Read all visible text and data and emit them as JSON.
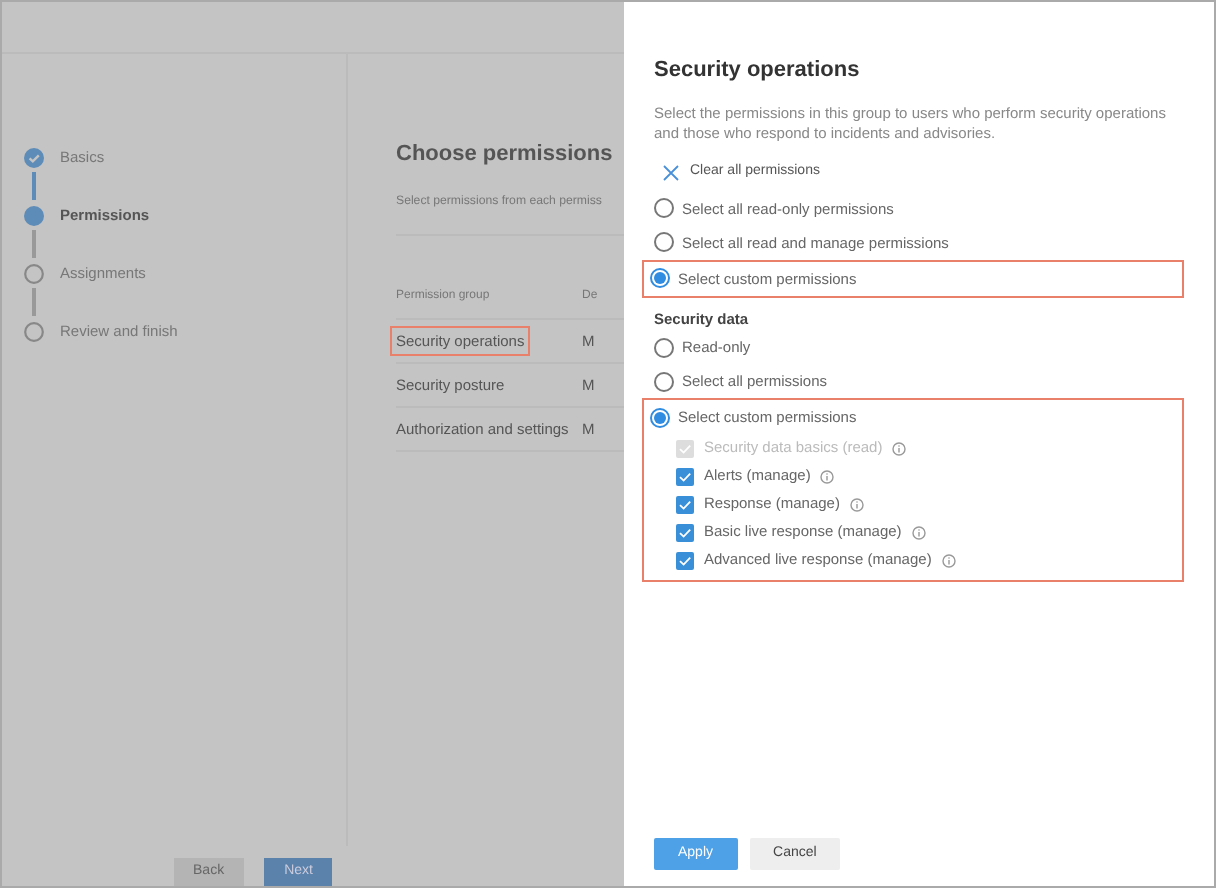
{
  "wizard": {
    "steps": [
      {
        "label": "Basics",
        "kind": "done"
      },
      {
        "label": "Permissions",
        "kind": "current"
      },
      {
        "label": "Assignments",
        "kind": "pending"
      },
      {
        "label": "Review and finish",
        "kind": "pending"
      }
    ],
    "title": "Choose permissions",
    "subtitle": "Select permissions from each permiss",
    "table": {
      "columns": [
        "Permission group",
        "De"
      ],
      "rows": [
        {
          "cells": [
            "Security operations",
            "M"
          ],
          "highlighted": true
        },
        {
          "cells": [
            "Security posture",
            "M"
          ],
          "highlighted": false
        },
        {
          "cells": [
            "Authorization and settings",
            "M"
          ],
          "highlighted": false
        }
      ]
    },
    "buttons": [
      "Back",
      "Next"
    ]
  },
  "panel": {
    "title": "Security operations",
    "description": "Select the permissions in this group to users who perform security operations and those who respond to incidents and advisories.",
    "clear_button": "Clear all permissions",
    "options": [
      {
        "label": "Select all read-only permissions",
        "selected": false,
        "highlighted": false
      },
      {
        "label": "Select all read and manage permissions",
        "selected": false,
        "highlighted": false
      },
      {
        "label": "Select custom permissions",
        "selected": true,
        "highlighted": true
      }
    ],
    "section": {
      "title": "Security data",
      "options": [
        {
          "label": "Read-only",
          "selected": false,
          "highlighted": false
        },
        {
          "label": "Select all permissions",
          "selected": false,
          "highlighted": false
        },
        {
          "label": "Select custom permissions",
          "selected": true,
          "highlighted": true
        }
      ],
      "checkboxes": [
        {
          "label": "Security data basics (read)",
          "checked": true,
          "disabled": true
        },
        {
          "label": "Alerts (manage)",
          "checked": true,
          "disabled": false
        },
        {
          "label": "Response (manage)",
          "checked": true,
          "disabled": false
        },
        {
          "label": "Basic live response (manage)",
          "checked": true,
          "disabled": false
        },
        {
          "label": "Advanced live response (manage)",
          "checked": true,
          "disabled": false
        }
      ]
    },
    "buttons": [
      "Apply",
      "Cancel"
    ]
  }
}
